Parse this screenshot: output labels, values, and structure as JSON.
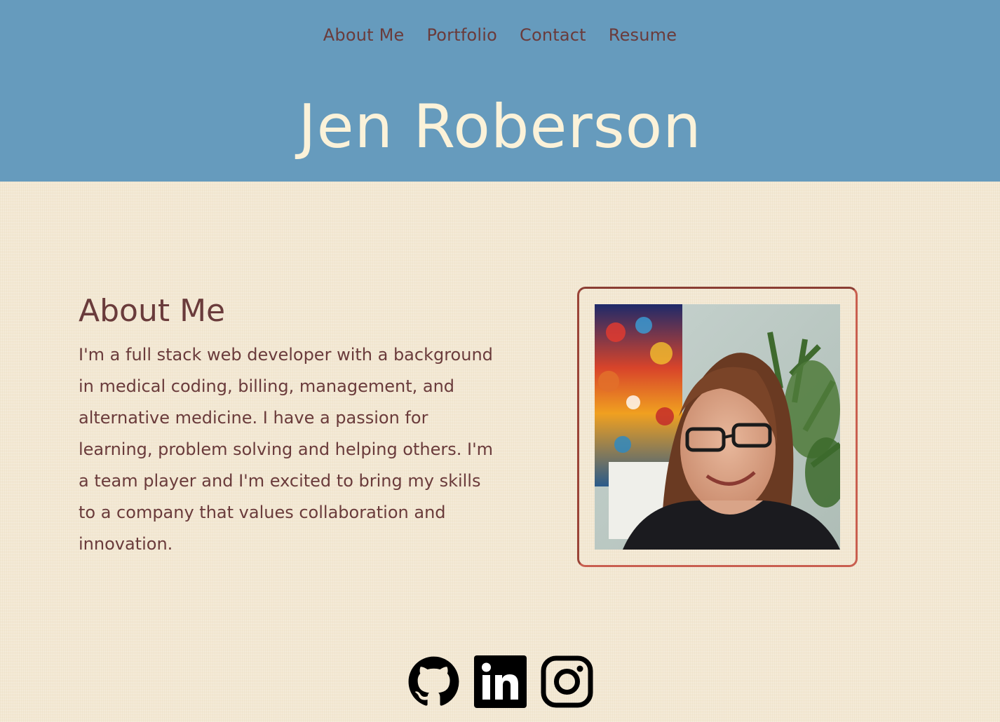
{
  "nav": {
    "items": [
      {
        "label": "About Me"
      },
      {
        "label": "Portfolio"
      },
      {
        "label": "Contact"
      },
      {
        "label": "Resume"
      }
    ]
  },
  "header": {
    "title": "Jen Roberson"
  },
  "about": {
    "heading": "About Me",
    "text": "I'm a full stack web developer with a background in medical coding, billing, management, and alternative medicine. I have a passion for learning, problem solving and helping others. I'm a team player and I'm excited to bring my skills to a company that values collaboration and innovation."
  },
  "social": {
    "icons": [
      "github-icon",
      "linkedin-icon",
      "instagram-icon"
    ]
  },
  "colors": {
    "header_bg": "#669bbd",
    "title": "#fbf2d9",
    "text": "#6a3b3b",
    "frame": "#c95f4f",
    "page_bg": "#f3e8d3"
  }
}
